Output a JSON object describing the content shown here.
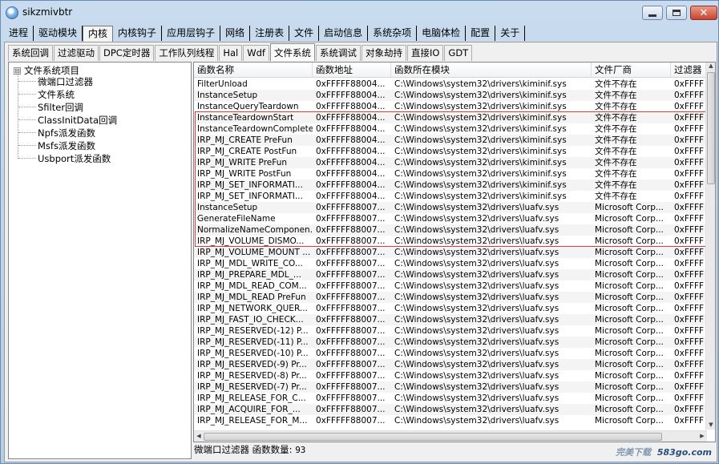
{
  "window": {
    "title": "sikzmivbtr"
  },
  "main_tabs": [
    "进程",
    "驱动模块",
    "内核",
    "内核钩子",
    "应用层钩子",
    "网络",
    "注册表",
    "文件",
    "启动信息",
    "系统杂项",
    "电脑体检",
    "配置",
    "关于"
  ],
  "main_tab_active": "内核",
  "sub_tabs": [
    "系统回调",
    "过滤驱动",
    "DPC定时器",
    "工作队列线程",
    "Hal",
    "Wdf",
    "文件系统",
    "系统调试",
    "对象劫持",
    "直接IO",
    "GDT"
  ],
  "sub_tab_active": "文件系统",
  "tree": {
    "root": "文件系统项目",
    "toggle": "⊟",
    "children": [
      "微端口过滤器",
      "文件系统",
      "Sfilter回调",
      "ClassInitData回调",
      "Npfs派发函数",
      "Msfs派发函数",
      "Usbport派发函数"
    ]
  },
  "table": {
    "columns": [
      "函数名称",
      "函数地址",
      "函数所在模块",
      "文件厂商",
      "过滤器"
    ],
    "rows": [
      [
        "FilterUnload",
        "0xFFFFF88004...",
        "C:\\Windows\\system32\\drivers\\kiminif.sys",
        "文件不存在",
        "0xFFFF"
      ],
      [
        "InstanceSetup",
        "0xFFFFF88004...",
        "C:\\Windows\\system32\\drivers\\kiminif.sys",
        "文件不存在",
        "0xFFFF"
      ],
      [
        "InstanceQueryTeardown",
        "0xFFFFF88004...",
        "C:\\Windows\\system32\\drivers\\kiminif.sys",
        "文件不存在",
        "0xFFFF"
      ],
      [
        "InstanceTeardownStart",
        "0xFFFFF88004...",
        "C:\\Windows\\system32\\drivers\\kiminif.sys",
        "文件不存在",
        "0xFFFF"
      ],
      [
        "InstanceTeardownComplete",
        "0xFFFFF88004...",
        "C:\\Windows\\system32\\drivers\\kiminif.sys",
        "文件不存在",
        "0xFFFF"
      ],
      [
        "IRP_MJ_CREATE PreFun",
        "0xFFFFF88004...",
        "C:\\Windows\\system32\\drivers\\kiminif.sys",
        "文件不存在",
        "0xFFFF"
      ],
      [
        "IRP_MJ_CREATE PostFun",
        "0xFFFFF88004...",
        "C:\\Windows\\system32\\drivers\\kiminif.sys",
        "文件不存在",
        "0xFFFF"
      ],
      [
        "IRP_MJ_WRITE PreFun",
        "0xFFFFF88004...",
        "C:\\Windows\\system32\\drivers\\kiminif.sys",
        "文件不存在",
        "0xFFFF"
      ],
      [
        "IRP_MJ_WRITE PostFun",
        "0xFFFFF88004...",
        "C:\\Windows\\system32\\drivers\\kiminif.sys",
        "文件不存在",
        "0xFFFF"
      ],
      [
        "IRP_MJ_SET_INFORMATI...",
        "0xFFFFF88004...",
        "C:\\Windows\\system32\\drivers\\kiminif.sys",
        "文件不存在",
        "0xFFFF"
      ],
      [
        "IRP_MJ_SET_INFORMATI...",
        "0xFFFFF88004...",
        "C:\\Windows\\system32\\drivers\\kiminif.sys",
        "文件不存在",
        "0xFFFF"
      ],
      [
        "InstanceSetup",
        "0xFFFFF88007...",
        "C:\\Windows\\system32\\drivers\\luafv.sys",
        "Microsoft Corp...",
        "0xFFFF"
      ],
      [
        "GenerateFileName",
        "0xFFFFF88007...",
        "C:\\Windows\\system32\\drivers\\luafv.sys",
        "Microsoft Corp...",
        "0xFFFF"
      ],
      [
        "NormalizeNameComponen...",
        "0xFFFFF88007...",
        "C:\\Windows\\system32\\drivers\\luafv.sys",
        "Microsoft Corp...",
        "0xFFFF"
      ],
      [
        "IRP_MJ_VOLUME_DISMO...",
        "0xFFFFF88007...",
        "C:\\Windows\\system32\\drivers\\luafv.sys",
        "Microsoft Corp...",
        "0xFFFF"
      ],
      [
        "IRP_MJ_VOLUME_MOUNT ...",
        "0xFFFFF88007...",
        "C:\\Windows\\system32\\drivers\\luafv.sys",
        "Microsoft Corp...",
        "0xFFFF"
      ],
      [
        "IRP_MJ_MDL_WRITE_CO...",
        "0xFFFFF88007...",
        "C:\\Windows\\system32\\drivers\\luafv.sys",
        "Microsoft Corp...",
        "0xFFFF"
      ],
      [
        "IRP_MJ_PREPARE_MDL_...",
        "0xFFFFF88007...",
        "C:\\Windows\\system32\\drivers\\luafv.sys",
        "Microsoft Corp...",
        "0xFFFF"
      ],
      [
        "IRP_MJ_MDL_READ_COM...",
        "0xFFFFF88007...",
        "C:\\Windows\\system32\\drivers\\luafv.sys",
        "Microsoft Corp...",
        "0xFFFF"
      ],
      [
        "IRP_MJ_MDL_READ PreFun",
        "0xFFFFF88007...",
        "C:\\Windows\\system32\\drivers\\luafv.sys",
        "Microsoft Corp...",
        "0xFFFF"
      ],
      [
        "IRP_MJ_NETWORK_QUER...",
        "0xFFFFF88007...",
        "C:\\Windows\\system32\\drivers\\luafv.sys",
        "Microsoft Corp...",
        "0xFFFF"
      ],
      [
        "IRP_MJ_FAST_IO_CHECK...",
        "0xFFFFF88007...",
        "C:\\Windows\\system32\\drivers\\luafv.sys",
        "Microsoft Corp...",
        "0xFFFF"
      ],
      [
        "IRP_MJ_RESERVED(-12) P...",
        "0xFFFFF88007...",
        "C:\\Windows\\system32\\drivers\\luafv.sys",
        "Microsoft Corp...",
        "0xFFFF"
      ],
      [
        "IRP_MJ_RESERVED(-11) P...",
        "0xFFFFF88007...",
        "C:\\Windows\\system32\\drivers\\luafv.sys",
        "Microsoft Corp...",
        "0xFFFF"
      ],
      [
        "IRP_MJ_RESERVED(-10) P...",
        "0xFFFFF88007...",
        "C:\\Windows\\system32\\drivers\\luafv.sys",
        "Microsoft Corp...",
        "0xFFFF"
      ],
      [
        "IRP_MJ_RESERVED(-9) Pr...",
        "0xFFFFF88007...",
        "C:\\Windows\\system32\\drivers\\luafv.sys",
        "Microsoft Corp...",
        "0xFFFF"
      ],
      [
        "IRP_MJ_RESERVED(-8) Pr...",
        "0xFFFFF88007...",
        "C:\\Windows\\system32\\drivers\\luafv.sys",
        "Microsoft Corp...",
        "0xFFFF"
      ],
      [
        "IRP_MJ_RESERVED(-7) Pr...",
        "0xFFFFF88007...",
        "C:\\Windows\\system32\\drivers\\luafv.sys",
        "Microsoft Corp...",
        "0xFFFF"
      ],
      [
        "IRP_MJ_RELEASE_FOR_C...",
        "0xFFFFF88007...",
        "C:\\Windows\\system32\\drivers\\luafv.sys",
        "Microsoft Corp...",
        "0xFFFF"
      ],
      [
        "IRP_MJ_ACQUIRE_FOR_...",
        "0xFFFFF88007...",
        "C:\\Windows\\system32\\drivers\\luafv.sys",
        "Microsoft Corp...",
        "0xFFFF"
      ],
      [
        "IRP_MJ_RELEASE_FOR_M...",
        "0xFFFFF88007...",
        "C:\\Windows\\system32\\drivers\\luafv.sys",
        "Microsoft Corp...",
        "0xFFFF"
      ]
    ],
    "highlighted_rows": 11
  },
  "status": {
    "label": "微端口过滤器 函数数量:",
    "count": "93"
  },
  "watermark": {
    "brand": "完美下载",
    "site": "583go.com"
  },
  "colors": {
    "highlight_border": "#e03a3a",
    "window_frame": "#b7cde4"
  }
}
